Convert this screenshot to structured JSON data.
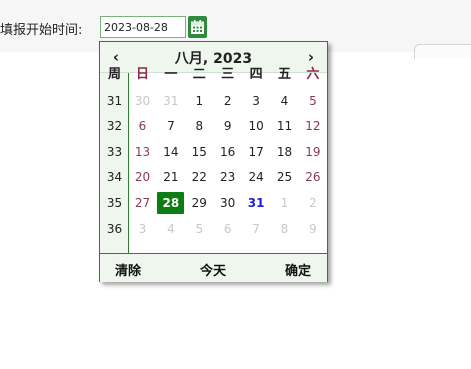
{
  "form": {
    "start_time_label": "填报开始时间:",
    "start_time_value": "2023-08-28"
  },
  "icons": {
    "calendar_button": "calendar-icon",
    "calendar_button_color": "#2e8b3e"
  },
  "datepicker": {
    "prev_label": "‹",
    "next_label": "›",
    "title": "八月, 2023",
    "week_header": "周",
    "weekdays": [
      "日",
      "一",
      "二",
      "三",
      "四",
      "五",
      "六"
    ],
    "weeks": [
      {
        "num": "31",
        "days": [
          {
            "d": "30",
            "state": "other"
          },
          {
            "d": "31",
            "state": "other"
          },
          {
            "d": "1",
            "state": "normal"
          },
          {
            "d": "2",
            "state": "normal"
          },
          {
            "d": "3",
            "state": "normal"
          },
          {
            "d": "4",
            "state": "normal"
          },
          {
            "d": "5",
            "state": "weekend"
          }
        ]
      },
      {
        "num": "32",
        "days": [
          {
            "d": "6",
            "state": "weekend"
          },
          {
            "d": "7",
            "state": "normal"
          },
          {
            "d": "8",
            "state": "normal"
          },
          {
            "d": "9",
            "state": "normal"
          },
          {
            "d": "10",
            "state": "normal"
          },
          {
            "d": "11",
            "state": "normal"
          },
          {
            "d": "12",
            "state": "weekend"
          }
        ]
      },
      {
        "num": "33",
        "days": [
          {
            "d": "13",
            "state": "weekend"
          },
          {
            "d": "14",
            "state": "normal"
          },
          {
            "d": "15",
            "state": "normal"
          },
          {
            "d": "16",
            "state": "normal"
          },
          {
            "d": "17",
            "state": "normal"
          },
          {
            "d": "18",
            "state": "normal"
          },
          {
            "d": "19",
            "state": "weekend"
          }
        ]
      },
      {
        "num": "34",
        "days": [
          {
            "d": "20",
            "state": "weekend"
          },
          {
            "d": "21",
            "state": "normal"
          },
          {
            "d": "22",
            "state": "normal"
          },
          {
            "d": "23",
            "state": "normal"
          },
          {
            "d": "24",
            "state": "normal"
          },
          {
            "d": "25",
            "state": "normal"
          },
          {
            "d": "26",
            "state": "weekend"
          }
        ]
      },
      {
        "num": "35",
        "days": [
          {
            "d": "27",
            "state": "weekend"
          },
          {
            "d": "28",
            "state": "selected"
          },
          {
            "d": "29",
            "state": "normal"
          },
          {
            "d": "30",
            "state": "normal"
          },
          {
            "d": "31",
            "state": "today"
          },
          {
            "d": "1",
            "state": "other"
          },
          {
            "d": "2",
            "state": "other"
          }
        ]
      },
      {
        "num": "36",
        "days": [
          {
            "d": "3",
            "state": "other"
          },
          {
            "d": "4",
            "state": "other"
          },
          {
            "d": "5",
            "state": "other"
          },
          {
            "d": "6",
            "state": "other"
          },
          {
            "d": "7",
            "state": "other"
          },
          {
            "d": "8",
            "state": "other"
          },
          {
            "d": "9",
            "state": "other"
          }
        ]
      }
    ],
    "footer": {
      "clear_label": "清除",
      "today_label": "今天",
      "ok_label": "确定"
    },
    "colors": {
      "accent": "#2e7d32",
      "selected_bg": "#0c7d15",
      "today_text": "#1f1fd8",
      "weekend_text": "#8b3a55",
      "other_month_text": "#c8c8c8"
    }
  }
}
